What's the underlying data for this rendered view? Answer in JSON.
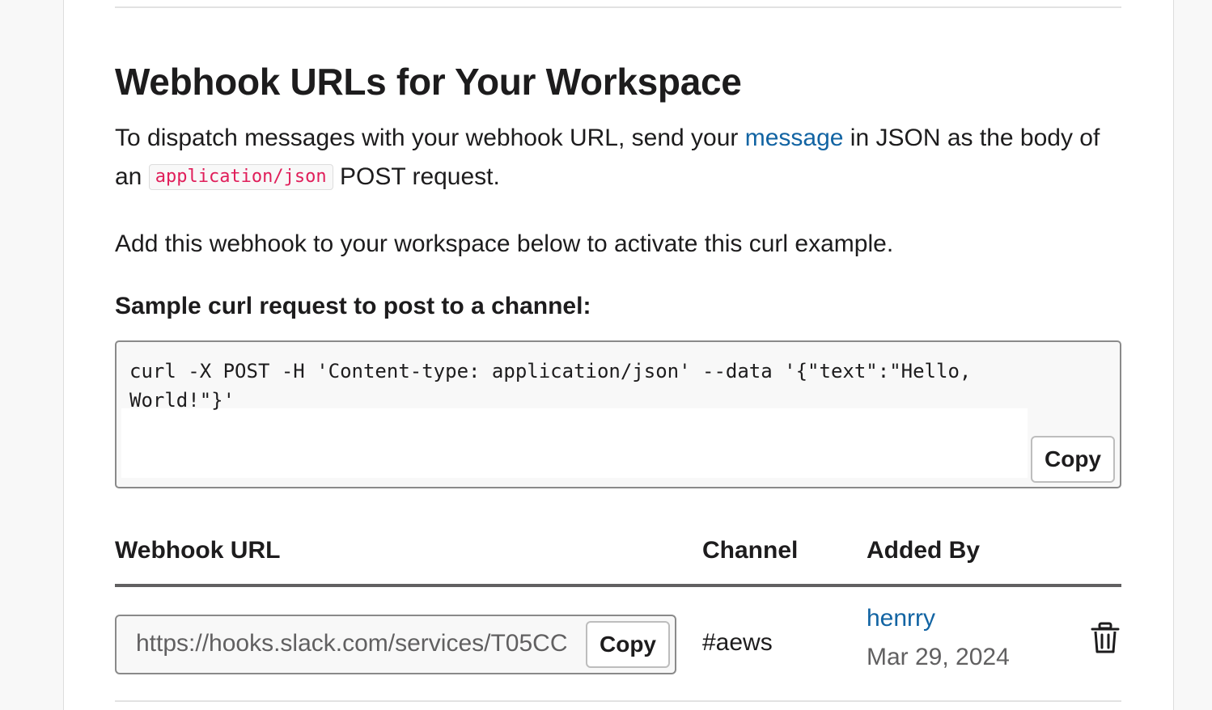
{
  "page": {
    "title": "Webhook URLs for Your Workspace",
    "intro": {
      "before_link": "To dispatch messages with your webhook URL, send your ",
      "link_text": "message",
      "after_link": " in JSON as the body of an ",
      "code": "application/json",
      "after_code": " POST request."
    },
    "activate_note": "Add this webhook to your workspace below to activate this curl example.",
    "sample_label": "Sample curl request to post to a channel:",
    "sample_code": "curl -X POST -H 'Content-type: application/json' --data '{\"text\":\"Hello, World!\"}'",
    "copy_label": "Copy"
  },
  "table": {
    "headers": {
      "url": "Webhook URL",
      "channel": "Channel",
      "added_by": "Added By"
    },
    "rows": [
      {
        "url": "https://hooks.slack.com/services/T05CC",
        "copy_label": "Copy",
        "channel": "#aews",
        "added_by": "henrry",
        "date": "Mar 29, 2024",
        "delete_icon": "trash-icon"
      }
    ]
  },
  "colors": {
    "link": "#1264a3",
    "code": "#e01e5a",
    "text": "#1d1c1d",
    "muted": "#616061"
  }
}
